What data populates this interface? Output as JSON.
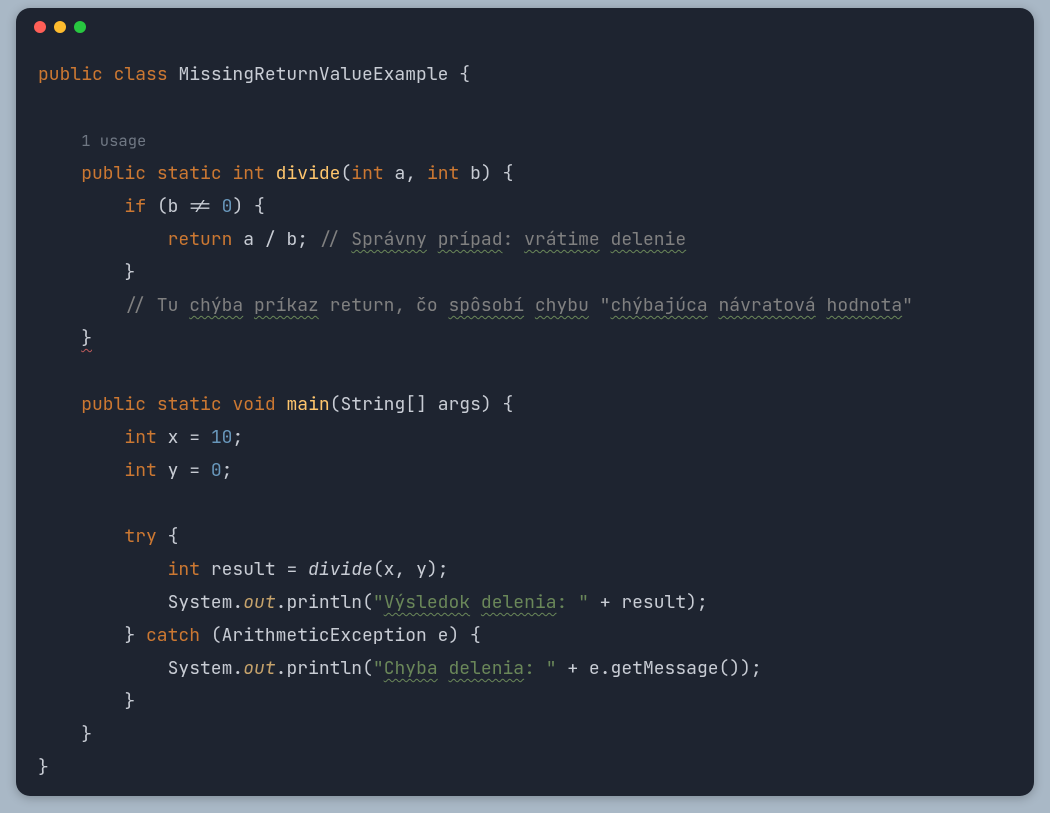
{
  "hint": "1 usage",
  "t": {
    "public": "public",
    "class": "class",
    "static": "static",
    "int": "int",
    "void": "void",
    "if": "if",
    "return": "return",
    "try": "try",
    "catch": "catch",
    "className": "MissingReturnValueExample",
    "divide": "divide",
    "main": "main",
    "a": "a",
    "b": "b",
    "args": "args",
    "String": "String",
    "x": "x",
    "y": "y",
    "result": "result",
    "System": "System",
    "out": "out",
    "println": "println",
    "ArithE": "ArithmeticException",
    "e": "e",
    "getMessage": "getMessage",
    "n10": "10",
    "n0": "0",
    "cm1a": "// ",
    "cm1w1": "Správny",
    "cm1w2": "prípad",
    "cm1p": ": ",
    "cm1w3": "vrátime",
    "cm1w4": "delenie",
    "cm2a": "// Tu ",
    "cm2w1": "chýba",
    "cm2w2": "príkaz",
    "cm2b": " return, čo ",
    "cm2w3": "spôsobí",
    "cm2w4": "chybu",
    "cm2c": " \"",
    "cm2w5": "chýbajúca",
    "cm2w6": "návratová",
    "cm2w7": "hodnota",
    "cm2d": "\"",
    "s1a": "\"",
    "s1w1": "Výsledok",
    "s1w2": "delenia",
    "s1b": ": \"",
    "s2a": "\"",
    "s2w1": "Chyba",
    "s2w2": "delenia",
    "s2b": ": \""
  }
}
